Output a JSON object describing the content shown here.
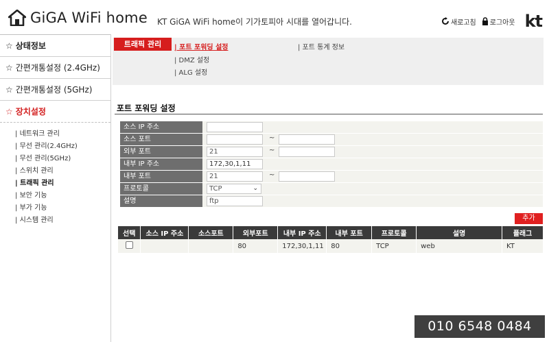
{
  "header": {
    "brand": "GiGA WiFi home",
    "slogan": "KT GiGA WiFi home이 기가토피아 시대를 열어갑니다.",
    "refresh_label": "새로고침",
    "logout_label": "로그아웃",
    "kt_logo": "kt"
  },
  "sidebar": {
    "items": [
      {
        "label": "상태정보"
      },
      {
        "label": "간편개통설정 (2.4GHz)"
      },
      {
        "label": "간편개통설정 (5GHz)"
      },
      {
        "label": "장치설정"
      }
    ],
    "sub_items": [
      {
        "label": "네트워크 관리"
      },
      {
        "label": "무선 관리(2.4GHz)"
      },
      {
        "label": "무선 관리(5GHz)"
      },
      {
        "label": "스위치 관리"
      },
      {
        "label": "트래픽 관리"
      },
      {
        "label": "보안 기능"
      },
      {
        "label": "부가 기능"
      },
      {
        "label": "시스템 관리"
      }
    ]
  },
  "tabs": {
    "active_label": "트래픽 관리",
    "links": [
      {
        "label": "| 포트 포워딩 설정"
      },
      {
        "label": "| 포트 통계 정보"
      },
      {
        "label": "| DMZ 설정"
      },
      {
        "label": "| ALG 설정"
      }
    ]
  },
  "section": {
    "title": "포트 포워딩 설정"
  },
  "form": {
    "source_ip_label": "소스 IP 주소",
    "source_ip_value": "",
    "source_port_label": "소스 포트",
    "source_port_from": "",
    "source_port_to": "",
    "external_port_label": "외부 포트",
    "external_port_from": "21",
    "external_port_to": "",
    "internal_ip_label": "내부 IP 주소",
    "internal_ip_value": "172,30,1,11",
    "internal_port_label": "내부 포트",
    "internal_port_from": "21",
    "internal_port_to": "",
    "protocol_label": "프로토콜",
    "protocol_value": "TCP",
    "description_label": "설명",
    "description_value": "ftp",
    "tilde": "~",
    "add_label": "추가"
  },
  "table": {
    "headers": [
      "선택",
      "소스 IP 주소",
      "소스포트",
      "외부포트",
      "내부 IP 주소",
      "내부 포트",
      "프로토콜",
      "설명",
      "플래그"
    ],
    "rows": [
      {
        "source_ip": "",
        "source_port": "",
        "external_port": "80",
        "internal_ip": "172,30,1,11",
        "internal_port": "80",
        "protocol": "TCP",
        "description": "web",
        "flag": "KT"
      }
    ]
  },
  "banner": {
    "phone": "010 6548 0484"
  },
  "colors": {
    "accent": "#d61d1d",
    "label_bg": "#6e6e6e",
    "header_bg": "#3a3a3a"
  }
}
